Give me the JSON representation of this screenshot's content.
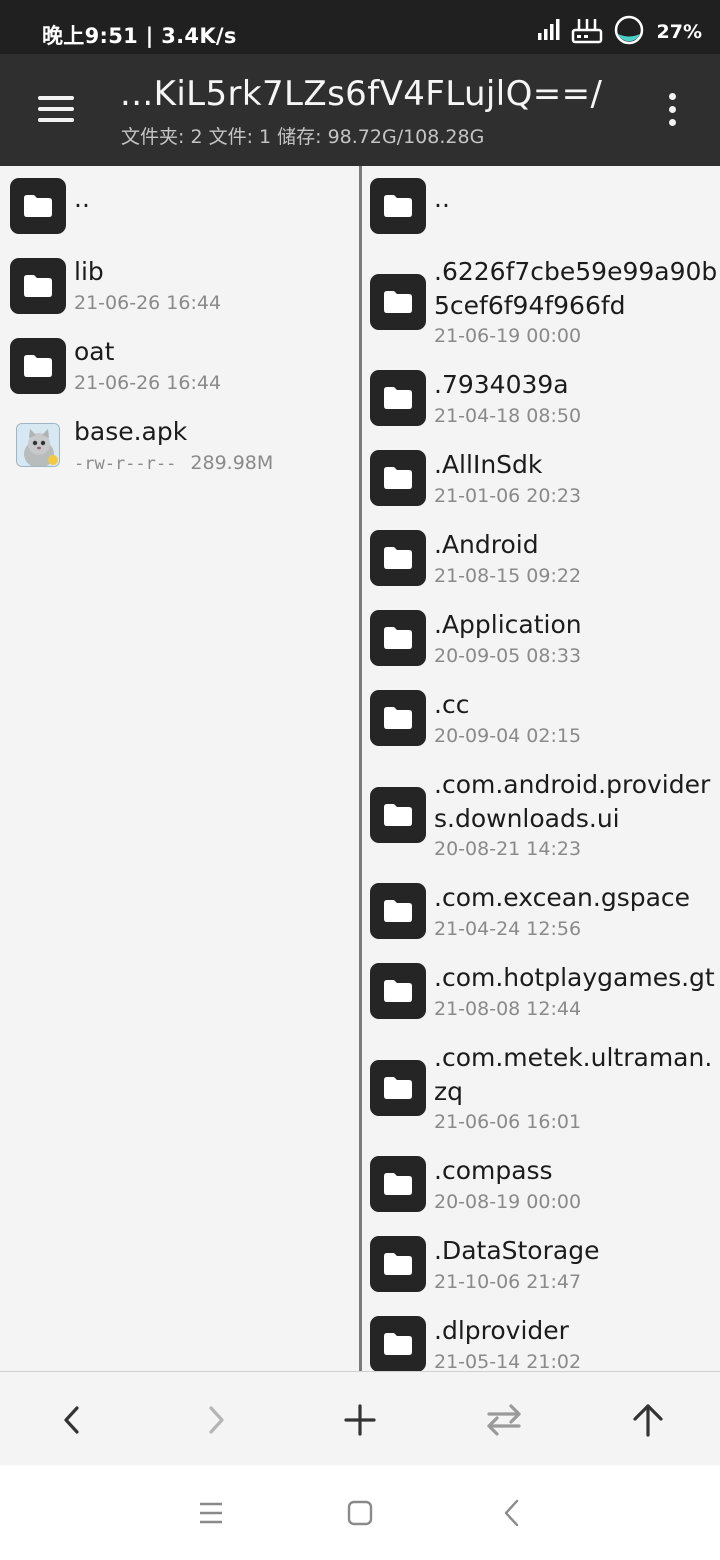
{
  "status_bar": {
    "time": "晚上9:51 | 3.4K/s",
    "battery_percent": "27%",
    "icons": [
      "signal-icon",
      "router-icon",
      "battery-ring-icon"
    ]
  },
  "app_bar": {
    "path": "...KiL5rk7LZs6fV4FLujlQ==/",
    "summary": "文件夹: 2  文件: 1  储存: 98.72G/108.28G",
    "icons": [
      "menu-icon",
      "more-vertical-icon"
    ]
  },
  "left_pane": {
    "parent": "..",
    "items": [
      {
        "name": "lib",
        "meta": "21-06-26 16:44"
      },
      {
        "name": "oat",
        "meta": "21-06-26 16:44"
      }
    ],
    "file": {
      "name": "base.apk",
      "perm": "-rw-r--r--",
      "size": "289.98M"
    }
  },
  "right_pane": {
    "parent": "..",
    "items": [
      {
        "name": ".6226f7cbe59e99a90b5cef6f94f966fd",
        "meta": "21-06-19 00:00"
      },
      {
        "name": ".7934039a",
        "meta": "21-04-18 08:50"
      },
      {
        "name": ".AllInSdk",
        "meta": "21-01-06 20:23"
      },
      {
        "name": ".Android",
        "meta": "21-08-15 09:22"
      },
      {
        "name": ".Application",
        "meta": "20-09-05 08:33"
      },
      {
        "name": ".cc",
        "meta": "20-09-04 02:15"
      },
      {
        "name": ".com.android.providers.downloads.ui",
        "meta": "20-08-21 14:23"
      },
      {
        "name": ".com.excean.gspace",
        "meta": "21-04-24 12:56"
      },
      {
        "name": ".com.hotplaygames.gt",
        "meta": "21-08-08 12:44"
      },
      {
        "name": ".com.metek.ultraman.zq",
        "meta": "21-06-06 16:01"
      },
      {
        "name": ".compass",
        "meta": "20-08-19 00:00"
      },
      {
        "name": ".DataStorage",
        "meta": "21-10-06 21:47"
      },
      {
        "name": ".dlprovider",
        "meta": "21-05-14 21:02"
      }
    ]
  },
  "toolbar": {
    "icons": [
      "back-arrow-icon",
      "forward-arrow-icon",
      "add-icon",
      "swap-panes-icon",
      "up-directory-icon"
    ]
  },
  "nav_bar": {
    "icons": [
      "recents-icon",
      "home-icon",
      "back-icon"
    ]
  },
  "colors": {
    "status_bar": "#202020",
    "app_bar": "#2f2f2f",
    "folder_tile": "#252525",
    "pane_bg": "#f4f4f4",
    "meta_text": "#8a8a8a"
  }
}
